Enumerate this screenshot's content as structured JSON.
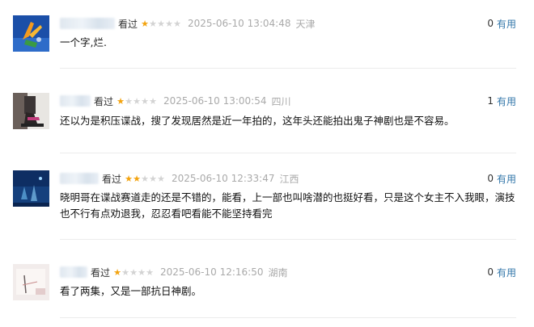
{
  "comments": [
    {
      "watched": "看过",
      "rating": 1,
      "time": "2025-06-10 13:04:48",
      "location": "天津",
      "votes": "0",
      "useful_label": "有用",
      "text": "一个字,烂."
    },
    {
      "watched": "看过",
      "rating": 1,
      "time": "2025-06-10 13:00:54",
      "location": "四川",
      "votes": "1",
      "useful_label": "有用",
      "text": "还以为是积压谍战，搜了发现居然是近一年拍的，这年头还能拍出鬼子神剧也是不容易。"
    },
    {
      "watched": "看过",
      "rating": 2,
      "time": "2025-06-10 12:33:47",
      "location": "江西",
      "votes": "0",
      "useful_label": "有用",
      "text": "晓明哥在谍战赛道走的还是不错的，能看，上一部也叫啥潜的也挺好看，只是这个女主不入我眼，演技也不行有点劝退我，忍忍看吧看能不能坚持看完"
    },
    {
      "watched": "看过",
      "rating": 1,
      "time": "2025-06-10 12:16:50",
      "location": "湖南",
      "votes": "0",
      "useful_label": "有用",
      "text": "看了两集，又是一部抗日神剧。"
    }
  ]
}
